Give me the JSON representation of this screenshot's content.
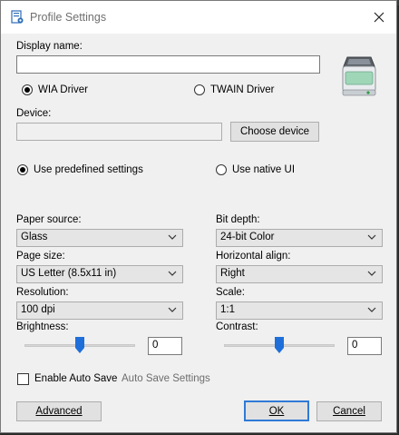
{
  "window": {
    "title": "Profile Settings"
  },
  "form": {
    "display_name_label": "Display name:",
    "display_name_value": "",
    "driver": {
      "wia_label": "WIA Driver",
      "twain_label": "TWAIN Driver",
      "selected": "WIA Driver"
    },
    "device_label": "Device:",
    "device_value": "",
    "choose_device_label": "Choose device",
    "settings_mode": {
      "predefined_label": "Use predefined settings",
      "native_label": "Use native UI",
      "selected": "Use predefined settings"
    },
    "paper_source": {
      "label": "Paper source:",
      "value": "Glass"
    },
    "bit_depth": {
      "label": "Bit depth:",
      "value": "24-bit Color"
    },
    "page_size": {
      "label": "Page size:",
      "value": "US Letter (8.5x11 in)"
    },
    "horizontal_align": {
      "label": "Horizontal align:",
      "value": "Right"
    },
    "resolution": {
      "label": "Resolution:",
      "value": "100 dpi"
    },
    "scale": {
      "label": "Scale:",
      "value": "1:1"
    },
    "brightness": {
      "label": "Brightness:",
      "value": "0",
      "level": 0.5
    },
    "contrast": {
      "label": "Contrast:",
      "value": "0",
      "level": 0.5
    },
    "auto_save": {
      "label": "Enable Auto Save",
      "checked": false,
      "settings_label": "Auto Save Settings"
    }
  },
  "buttons": {
    "advanced": "Advanced",
    "ok": "OK",
    "cancel": "Cancel"
  },
  "colors": {
    "accent": "#2f7ad6",
    "thumb": "#1e6fd9"
  }
}
